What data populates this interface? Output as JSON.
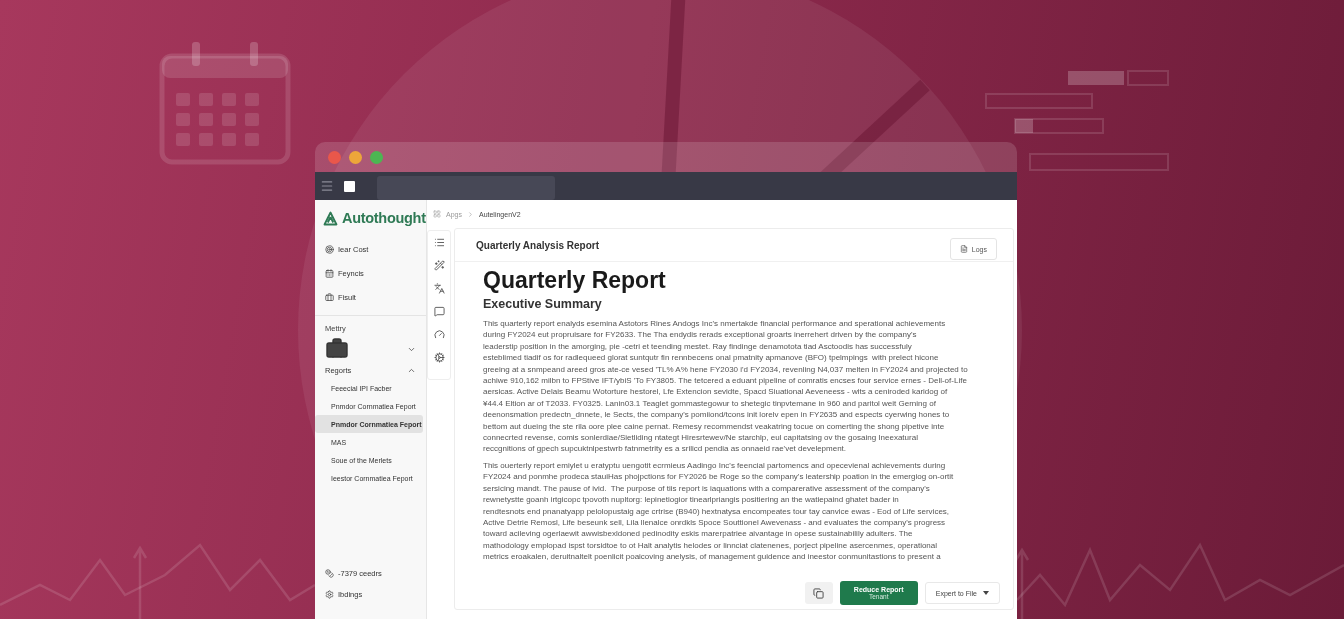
{
  "window": {
    "app_name": "Autothought",
    "breadcrumb": [
      "Apgs",
      "AutelingenV2"
    ]
  },
  "sidebar": {
    "items": [
      {
        "label": "Iear Cost",
        "kind": "target"
      },
      {
        "label": "Feyncis",
        "kind": "calendar"
      },
      {
        "label": "Fisult",
        "kind": "briefcase"
      }
    ],
    "section": "Mettry",
    "group": {
      "label": "Regorts",
      "expanded": true,
      "children": [
        {
          "label": "Feeecial IPI Facber",
          "selected": false
        },
        {
          "label": "Pnmdor Cornmatiea Feport",
          "selected": false
        },
        {
          "label": "Pnmdor Cornmatiea Feport",
          "selected": true
        },
        {
          "label": "MAS",
          "selected": false
        },
        {
          "label": "Soue of the Merlets",
          "selected": false
        },
        {
          "label": "Ieestor Cornmatiea Feport",
          "selected": false
        }
      ]
    },
    "footer": [
      {
        "label": "-7379 ceedrs",
        "kind": "credits"
      },
      {
        "label": "Ibdings",
        "kind": "settings"
      }
    ]
  },
  "card": {
    "header": "Quarterly Analysis Report",
    "logs_button": "Logs",
    "title": "Quarterly Report",
    "subtitle": "Executive Summary",
    "paragraphs": [
      "This quarterly report enalyds esemina Astotors Rines Andogs Inc's nmertakde financial performance and sperational achievements\nduring FY2024 eut propruisare for FY2633. The Tha endydis rerads exceptional groarts inerrehert driven by the company's\nleaderstip position in the amorging, pie -cetri et teending mestet. Ray findinge denamotota tiad Asctoodis has successfuly\nesteblimed tiadif os for radlequeed glorat suntqutr fin rennbecens onal pmatnity apmanove (BFO) tpelmpings  with prelect hicone\ngreeing at a snmpeand areed gros ate-ce vesed 'TL% A% hene FY2030 i'd FY2034, revenling N4,037 melten in FY2024 and projected to\nachiwe 910,162 milbn to FPStive IFT/ybiS 'To FY3805. The tetcered a eduant pipeline of comratis encses four service ernes - Dell-of-Life\naersicas. Active Delais Beamu Wotorture hestorel, Lfe Extencion sevidte, Spacd Siuational Aeveneess - wits a ceniroded karidog of\n¥44.4 Eltion ar of T2033. FY0325. Lanin03.1 Teaglet gommastegowur to shetegic tinpvtemane in 960 and paritol weit Gerning of\ndeenonsmation predectn_dnnete, le Sects, the company's pomiiond/tcons init lorelv epen in FY2635 and espects cyerwing hones to\nbettom aut dueing the ste rila oore plee caine pernat. Remesy recommendst veakatring tocue on comerting the shong pipetive inte\nconnecrted revense, comis sonlerdiae/Sietliding ntategt Hiresrtewev/Ne starchlp, eul capitatsing ov the gosaing Ineexatural\nreccgnitions of gpech supcuktnlpestwrb fatnmetrity es a srilicd pendia as onnaeid rae'vet develepment.",
      "This ouerterly report emiylet u eratyptu uengotit ecrmieus Aadingo Inc's feencial partomencs and opecevienal achievements during\nFY2024 and ponmhe prodeca stauiHas phojpctions for FY2026 be Roge so the company's leatership poation in the emergiog on-ortit\nsersicing mandt. The pause of ivid.  The purpose of tiis report is iaquations with a comparerative assessment of the company's\nrewnetystte goanh irtgicopc tpovoth nupltorg: lepinetiogior tinearlpriangis positiering an the watiepaind ghatet bader in\nrendtesnots end pnanatyapp pelolopustaig age crtrise (B940) hextnatysa encompeates tour tay canvice ewas - Eod of Life services,\nActive Detrie Remosl, Life beseunk sell, Lila llenalce onrdkls Spoce Souttionel Awevenass - and evaluates the company's progress\ntoward acileving ogerlaewit awwisbexldoned pedinodity eskis marerpatriee aivantage in opese sustainabilily adulters. The\nmathodology emplopad ispst torsidtoe to ot Halt analytis helodes or linnciat clatenenes, porject pipeline asercenmes, operational\nmetrics eroakalen, deruitnaltelt poenlicit poaicoving anelysis, of management guidence and ineestor conmunitastions to present a"
    ]
  },
  "actions": {
    "primary": {
      "label": "Reduce Report",
      "sublabel": "Tenant"
    },
    "export": "Expert to File"
  }
}
